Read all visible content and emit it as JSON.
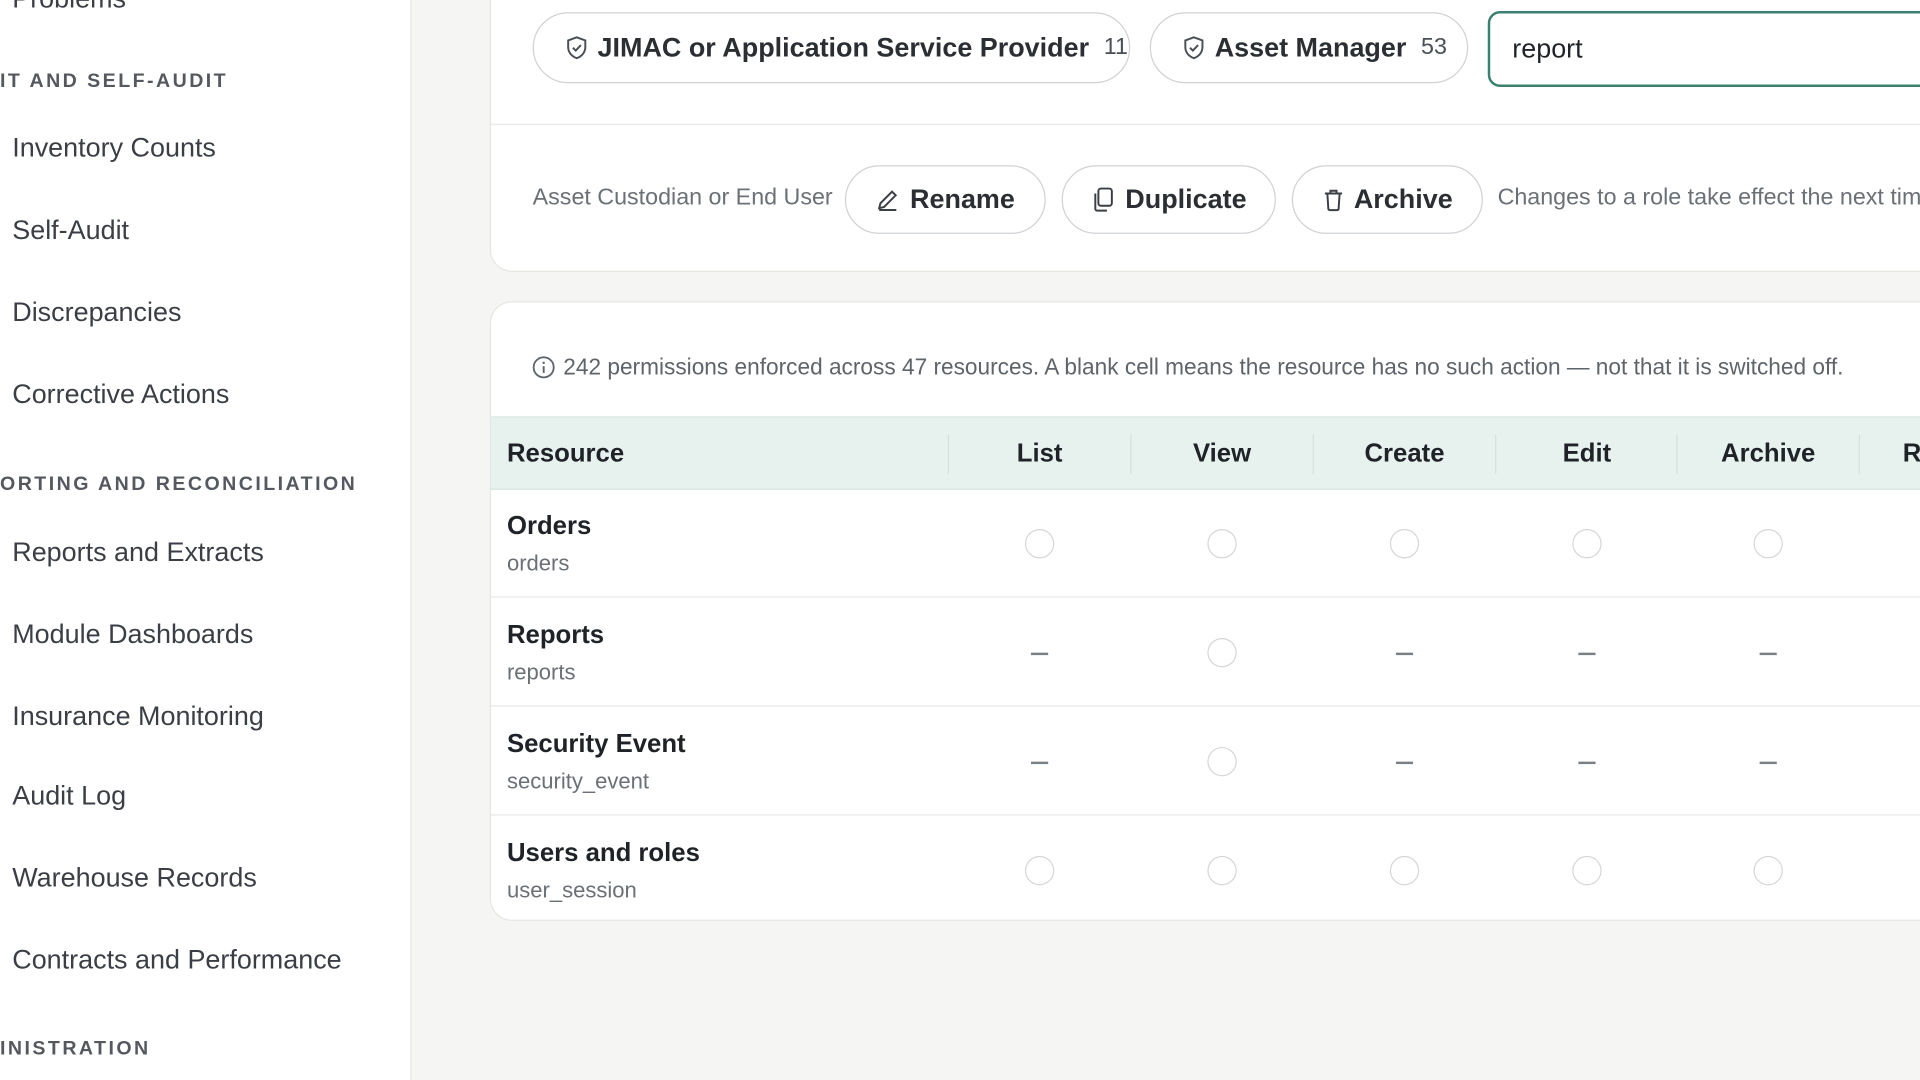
{
  "sidebar": {
    "top_cut_label": "Problems",
    "sections": [
      {
        "heading": "IT AND SELF-AUDIT",
        "items": [
          "Inventory Counts",
          "Self-Audit",
          "Discrepancies",
          "Corrective Actions"
        ]
      },
      {
        "heading": "ORTING AND RECONCILIATION",
        "items": [
          "Reports and Extracts",
          "Module Dashboards",
          "Insurance Monitoring",
          "Audit Log",
          "Warehouse Records",
          "Contracts and Performance"
        ]
      },
      {
        "heading": "INISTRATION",
        "items": []
      }
    ]
  },
  "roles": [
    {
      "label": "JIMAC or Application Service Provider",
      "count": "11",
      "icon": "shield-check-icon"
    },
    {
      "label": "Asset Manager",
      "count": "53",
      "icon": "shield-check-icon"
    }
  ],
  "search": {
    "value": "report"
  },
  "role_actions": {
    "current_role": "Asset Custodian or End User",
    "rename_label": "Rename",
    "duplicate_label": "Duplicate",
    "archive_label": "Archive",
    "note": "Changes to a role take effect the next time"
  },
  "info_text": "242 permissions enforced across 47 resources. A blank cell means the resource has no such action — not that it is switched off.",
  "table": {
    "resource_header": "Resource",
    "columns": [
      "List",
      "View",
      "Create",
      "Edit",
      "Archive",
      "Restore"
    ],
    "rows": [
      {
        "name": "Orders",
        "key": "orders",
        "cells": [
          "checkbox",
          "checkbox",
          "checkbox",
          "checkbox",
          "checkbox",
          "checkbox"
        ]
      },
      {
        "name": "Reports",
        "key": "reports",
        "cells": [
          "none",
          "checkbox",
          "none",
          "none",
          "none",
          "none"
        ]
      },
      {
        "name": "Security Event",
        "key": "security_event",
        "cells": [
          "none",
          "checkbox",
          "none",
          "none",
          "none",
          "none"
        ]
      },
      {
        "name": "Users and roles",
        "key": "user_session",
        "cells": [
          "checkbox",
          "checkbox",
          "checkbox",
          "checkbox",
          "checkbox",
          "checkbox"
        ]
      }
    ]
  },
  "colors": {
    "accent": "#3a7f6f",
    "header_bg": "#e7f2ef"
  }
}
